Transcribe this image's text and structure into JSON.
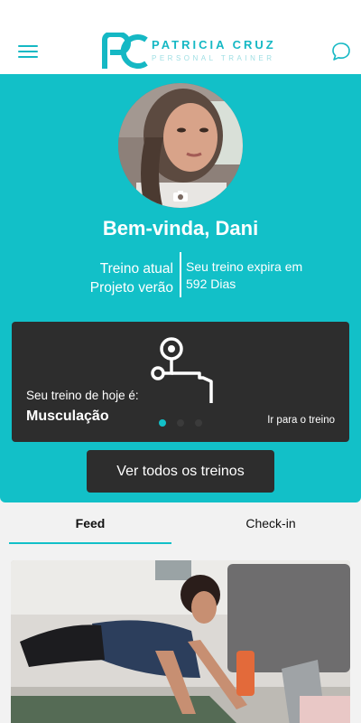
{
  "header": {
    "brand_name": "PATRICIA CRUZ",
    "brand_subtitle": "PERSONAL TRAINER",
    "logo_monogram": "PC",
    "menu_icon": "hamburger-menu-icon",
    "chat_icon": "chat-bubble-icon"
  },
  "profile": {
    "camera_icon": "camera-icon",
    "welcome": "Bem-vinda, Dani",
    "workout_label": "Treino atual",
    "workout_name": "Projeto verão",
    "expires_line1": "Seu treino expira em",
    "expires_line2": "592 Dias"
  },
  "today_card": {
    "icon": "workout-bench-icon",
    "label": "Seu treino de hoje é:",
    "title": "Musculação",
    "link": "Ir para o treino",
    "carousel_active_index": 0,
    "carousel_count": 3
  },
  "buttons": {
    "all_workouts": "Ver todos os treinos"
  },
  "tabs": [
    {
      "label": "Feed",
      "active": true
    },
    {
      "label": "Check-in",
      "active": false
    }
  ],
  "colors": {
    "accent": "#12c0c8",
    "dark_card": "#2d2d2d",
    "white": "#ffffff"
  }
}
